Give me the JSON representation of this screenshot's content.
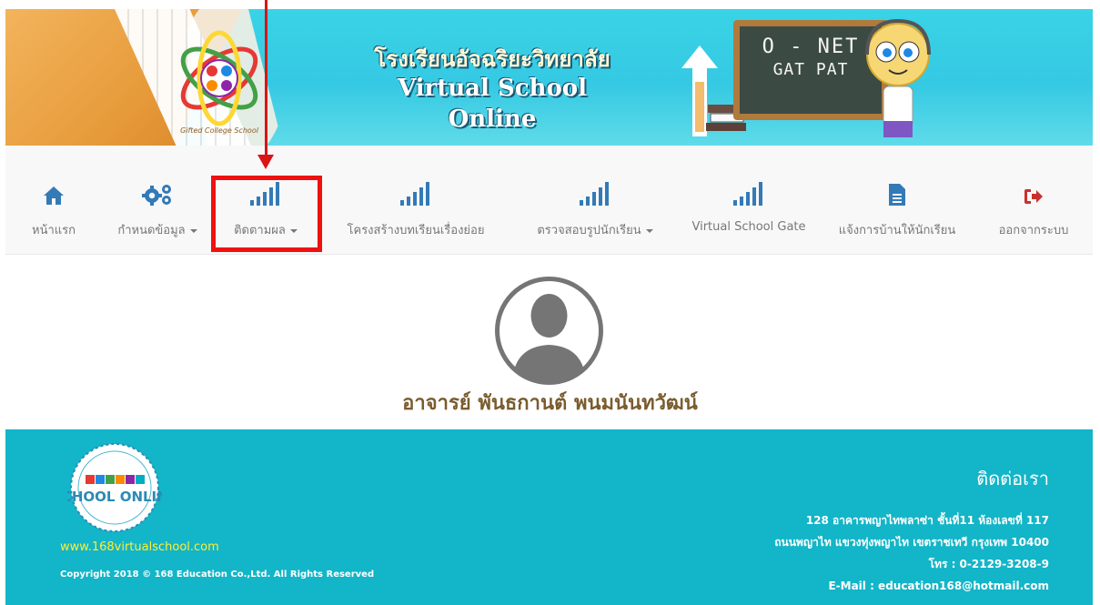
{
  "banner": {
    "title_th": "โรงเรียนอัจฉริยะวิทยาลัย",
    "title_en": "Virtual School Online",
    "chalkboard_line1": "O - NET",
    "chalkboard_line2": "GAT PAT",
    "logo_icon": "gifted-college-school-logo",
    "logo_text": "Gifted College School"
  },
  "nav": {
    "items": [
      {
        "label": "หน้าแรก",
        "icon": "home-icon",
        "dropdown": false
      },
      {
        "label": "กำหนดข้อมูล",
        "icon": "gears-icon",
        "dropdown": true
      },
      {
        "label": "ติดตามผล",
        "icon": "signal-bars-icon",
        "dropdown": true,
        "highlighted": true
      },
      {
        "label": "โครงสร้างบทเรียนเรื่องย่อย",
        "icon": "signal-bars-icon",
        "dropdown": false
      },
      {
        "label": "ตรวจสอบรูปนักเรียน",
        "icon": "signal-bars-icon",
        "dropdown": true
      },
      {
        "label": "Virtual School Gate",
        "icon": "signal-bars-icon",
        "dropdown": false
      },
      {
        "label": "แจ้งการบ้านให้นักเรียน",
        "icon": "document-icon",
        "dropdown": false
      },
      {
        "label": "ออกจากระบบ",
        "icon": "sign-out-icon",
        "dropdown": false
      }
    ]
  },
  "profile": {
    "name": "อาจารย์ พันธกานต์ พนมนันทวัฒน์",
    "avatar_icon": "user-avatar-icon"
  },
  "footer": {
    "logo_text": "SCHOOL ONLINE",
    "site_url": "www.168virtualschool.com",
    "copyright": "Copyright 2018 © 168 Education Co.,Ltd. All Rights Reserved",
    "contact_heading": "ติดต่อเรา",
    "address_line1": "128 อาคารพญาไทพลาซ่า ชั้นที่11 ห้องเลขที่ 117",
    "address_line2": "ถนนพญาไท แขวงทุ่งพญาไท เขตราชเทวี กรุงเทพ 10400",
    "phone": "โทร : 0-2129-3208-9",
    "email": "E-Mail : education168@hotmail.com"
  },
  "colors": {
    "nav_icon": "#337ab7",
    "logout_icon": "#c9302c",
    "highlight": "#ee1111",
    "footer_bg": "#13b5c8",
    "banner_bg": "#39d3e6",
    "name_text": "#7a5c2e",
    "url_text": "#ffee33"
  }
}
